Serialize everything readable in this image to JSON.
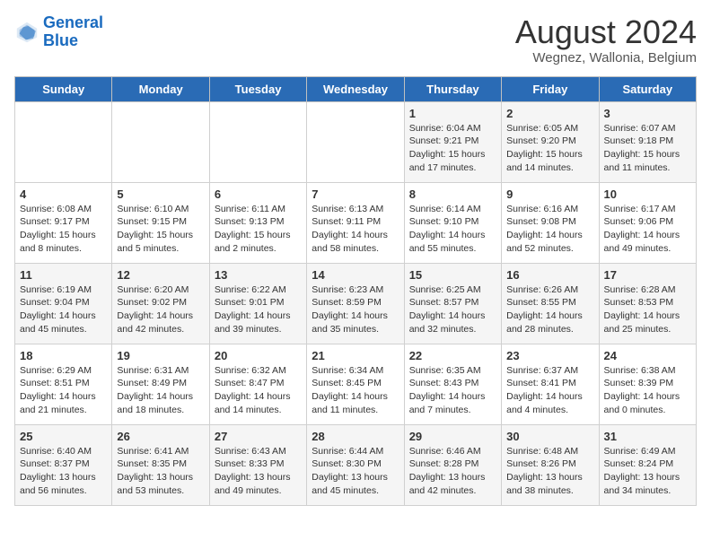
{
  "header": {
    "logo_line1": "General",
    "logo_line2": "Blue",
    "month": "August 2024",
    "location": "Wegnez, Wallonia, Belgium"
  },
  "days_of_week": [
    "Sunday",
    "Monday",
    "Tuesday",
    "Wednesday",
    "Thursday",
    "Friday",
    "Saturday"
  ],
  "weeks": [
    [
      {
        "day": "",
        "content": ""
      },
      {
        "day": "",
        "content": ""
      },
      {
        "day": "",
        "content": ""
      },
      {
        "day": "",
        "content": ""
      },
      {
        "day": "1",
        "content": "Sunrise: 6:04 AM\nSunset: 9:21 PM\nDaylight: 15 hours and 17 minutes."
      },
      {
        "day": "2",
        "content": "Sunrise: 6:05 AM\nSunset: 9:20 PM\nDaylight: 15 hours and 14 minutes."
      },
      {
        "day": "3",
        "content": "Sunrise: 6:07 AM\nSunset: 9:18 PM\nDaylight: 15 hours and 11 minutes."
      }
    ],
    [
      {
        "day": "4",
        "content": "Sunrise: 6:08 AM\nSunset: 9:17 PM\nDaylight: 15 hours and 8 minutes."
      },
      {
        "day": "5",
        "content": "Sunrise: 6:10 AM\nSunset: 9:15 PM\nDaylight: 15 hours and 5 minutes."
      },
      {
        "day": "6",
        "content": "Sunrise: 6:11 AM\nSunset: 9:13 PM\nDaylight: 15 hours and 2 minutes."
      },
      {
        "day": "7",
        "content": "Sunrise: 6:13 AM\nSunset: 9:11 PM\nDaylight: 14 hours and 58 minutes."
      },
      {
        "day": "8",
        "content": "Sunrise: 6:14 AM\nSunset: 9:10 PM\nDaylight: 14 hours and 55 minutes."
      },
      {
        "day": "9",
        "content": "Sunrise: 6:16 AM\nSunset: 9:08 PM\nDaylight: 14 hours and 52 minutes."
      },
      {
        "day": "10",
        "content": "Sunrise: 6:17 AM\nSunset: 9:06 PM\nDaylight: 14 hours and 49 minutes."
      }
    ],
    [
      {
        "day": "11",
        "content": "Sunrise: 6:19 AM\nSunset: 9:04 PM\nDaylight: 14 hours and 45 minutes."
      },
      {
        "day": "12",
        "content": "Sunrise: 6:20 AM\nSunset: 9:02 PM\nDaylight: 14 hours and 42 minutes."
      },
      {
        "day": "13",
        "content": "Sunrise: 6:22 AM\nSunset: 9:01 PM\nDaylight: 14 hours and 39 minutes."
      },
      {
        "day": "14",
        "content": "Sunrise: 6:23 AM\nSunset: 8:59 PM\nDaylight: 14 hours and 35 minutes."
      },
      {
        "day": "15",
        "content": "Sunrise: 6:25 AM\nSunset: 8:57 PM\nDaylight: 14 hours and 32 minutes."
      },
      {
        "day": "16",
        "content": "Sunrise: 6:26 AM\nSunset: 8:55 PM\nDaylight: 14 hours and 28 minutes."
      },
      {
        "day": "17",
        "content": "Sunrise: 6:28 AM\nSunset: 8:53 PM\nDaylight: 14 hours and 25 minutes."
      }
    ],
    [
      {
        "day": "18",
        "content": "Sunrise: 6:29 AM\nSunset: 8:51 PM\nDaylight: 14 hours and 21 minutes."
      },
      {
        "day": "19",
        "content": "Sunrise: 6:31 AM\nSunset: 8:49 PM\nDaylight: 14 hours and 18 minutes."
      },
      {
        "day": "20",
        "content": "Sunrise: 6:32 AM\nSunset: 8:47 PM\nDaylight: 14 hours and 14 minutes."
      },
      {
        "day": "21",
        "content": "Sunrise: 6:34 AM\nSunset: 8:45 PM\nDaylight: 14 hours and 11 minutes."
      },
      {
        "day": "22",
        "content": "Sunrise: 6:35 AM\nSunset: 8:43 PM\nDaylight: 14 hours and 7 minutes."
      },
      {
        "day": "23",
        "content": "Sunrise: 6:37 AM\nSunset: 8:41 PM\nDaylight: 14 hours and 4 minutes."
      },
      {
        "day": "24",
        "content": "Sunrise: 6:38 AM\nSunset: 8:39 PM\nDaylight: 14 hours and 0 minutes."
      }
    ],
    [
      {
        "day": "25",
        "content": "Sunrise: 6:40 AM\nSunset: 8:37 PM\nDaylight: 13 hours and 56 minutes."
      },
      {
        "day": "26",
        "content": "Sunrise: 6:41 AM\nSunset: 8:35 PM\nDaylight: 13 hours and 53 minutes."
      },
      {
        "day": "27",
        "content": "Sunrise: 6:43 AM\nSunset: 8:33 PM\nDaylight: 13 hours and 49 minutes."
      },
      {
        "day": "28",
        "content": "Sunrise: 6:44 AM\nSunset: 8:30 PM\nDaylight: 13 hours and 45 minutes."
      },
      {
        "day": "29",
        "content": "Sunrise: 6:46 AM\nSunset: 8:28 PM\nDaylight: 13 hours and 42 minutes."
      },
      {
        "day": "30",
        "content": "Sunrise: 6:48 AM\nSunset: 8:26 PM\nDaylight: 13 hours and 38 minutes."
      },
      {
        "day": "31",
        "content": "Sunrise: 6:49 AM\nSunset: 8:24 PM\nDaylight: 13 hours and 34 minutes."
      }
    ]
  ]
}
